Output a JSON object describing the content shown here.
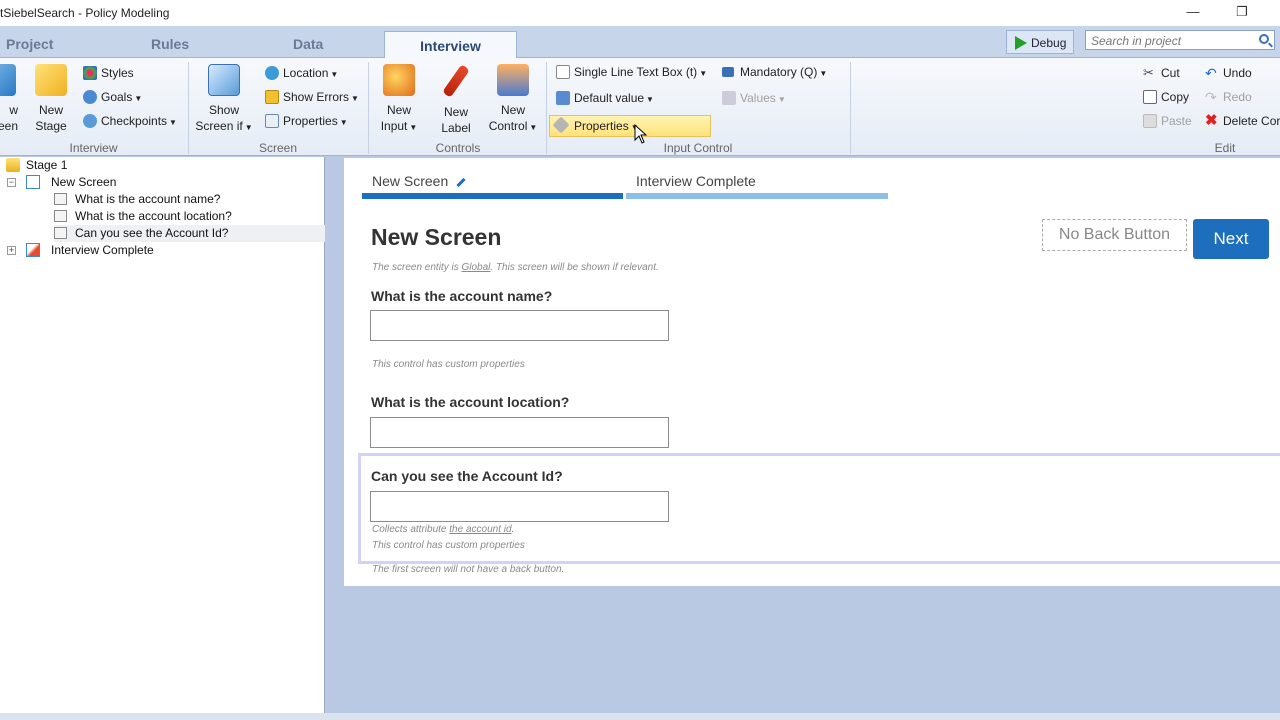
{
  "window": {
    "title": "tSiebelSearch - Policy Modeling",
    "minimize": "—",
    "restore": "❐"
  },
  "tabs": [
    {
      "label": "Project"
    },
    {
      "label": "Rules"
    },
    {
      "label": "Data"
    },
    {
      "label": "Interview"
    }
  ],
  "toolbar": {
    "debug_label": "Debug",
    "search_placeholder": "Search in project"
  },
  "ribbon": {
    "interview": {
      "label": "Interview",
      "new_screen_partial": [
        "w",
        "een"
      ],
      "new_stage": [
        "New",
        "Stage"
      ],
      "styles": "Styles",
      "goals": "Goals",
      "checkpoints": "Checkpoints"
    },
    "screen": {
      "label": "Screen",
      "show_screen_if": [
        "Show",
        "Screen if"
      ],
      "location": "Location",
      "show_errors": "Show Errors",
      "properties": "Properties"
    },
    "controls": {
      "label": "Controls",
      "new_input": [
        "New",
        "Input"
      ],
      "new_label": [
        "New",
        "Label"
      ],
      "new_control": [
        "New",
        "Control"
      ]
    },
    "input_control": {
      "label": "Input Control",
      "single_line": "Single Line Text Box (t)",
      "default_value": "Default value",
      "properties": "Properties",
      "mandatory": "Mandatory (Q)",
      "values": "Values"
    },
    "edit": {
      "label": "Edit",
      "cut": "Cut",
      "copy": "Copy",
      "paste": "Paste",
      "undo": "Undo",
      "redo": "Redo",
      "delete": "Delete Cor"
    }
  },
  "tree": {
    "stage": "Stage 1",
    "screen": "New Screen",
    "items": [
      "What is the account name?",
      "What is the account location?",
      "Can you see the Account Id?"
    ],
    "interview_complete": "Interview Complete"
  },
  "screen": {
    "progress": [
      "New Screen",
      "Interview Complete"
    ],
    "title": "New Screen",
    "entity_note_prefix": "The screen entity is ",
    "entity_note_link": "Global",
    "entity_note_suffix": ". This screen will be shown if relevant.",
    "no_back_button": "No Back Button",
    "next": "Next",
    "questions": [
      {
        "label": "What is the account name?",
        "note": "This control has custom properties"
      },
      {
        "label": "What is the account location?"
      },
      {
        "label": "Can you see the Account Id?",
        "note_prefix": "Collects attribute ",
        "note_link": "the account id",
        "note_suffix": ".",
        "note2": "This control has custom properties"
      }
    ],
    "footer_note": "The first screen will not have a back button."
  },
  "colors": {
    "accent": "#1d6ebd",
    "progress_done": "#1d6ebd",
    "progress_todo": "#8cc0e8"
  }
}
